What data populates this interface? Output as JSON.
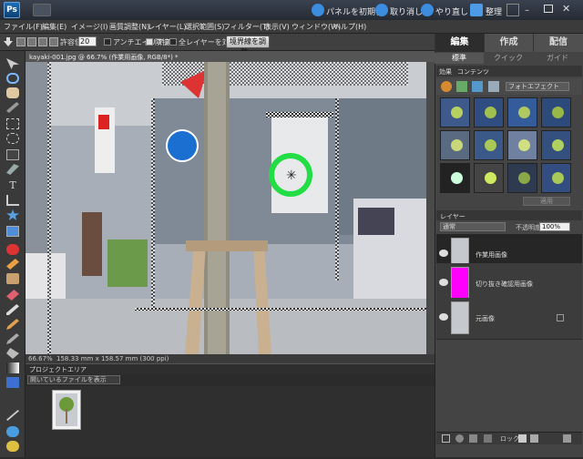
{
  "app": {
    "logo_text": "Ps"
  },
  "titlebar": {
    "reset_panels_label": "パネルを初期化",
    "undo_label": "取り消し",
    "redo_label": "やり直し",
    "organize_label": "整理"
  },
  "menu": [
    "ファイル(F)",
    "編集(E)",
    "イメージ(I)",
    "画質調整(N)",
    "レイヤー(L)",
    "選択範囲(S)",
    "フィルター(T)",
    "表示(V)",
    "ウィンドウ(W)",
    "ヘルプ(H)"
  ],
  "options": {
    "tolerance_label": "許容値:",
    "tolerance_value": "20",
    "antialias_label": "アンチエイリアス",
    "contiguous_label": "隣接",
    "all_layers_label": "全レイヤーを対象",
    "refine_edge_label": "境界線を調整..."
  },
  "document": {
    "tab_title": "kayaki-001.jpg @ 66.7% (作業用画像, RGB/8*) *",
    "zoom": "66.67%",
    "doc_size": "158.33 mm x 158.57 mm (300 ppi)"
  },
  "project_bin": {
    "title": "プロジェクトエリア",
    "filter_label": "開いているファイルを表示"
  },
  "right_panel": {
    "tabs": [
      "編集",
      "作成",
      "配信"
    ],
    "subtabs": [
      "標準",
      "クイック",
      "ガイド"
    ],
    "panel_tabs": [
      "効果",
      "コンテンツ"
    ],
    "effects_category": "フォトエフェクト",
    "apply_label": "適用",
    "layers_title": "レイヤー",
    "blend_mode": "通常",
    "opacity_label": "不透明度:",
    "opacity_value": "100%",
    "lock_label": "ロック:"
  },
  "layers": [
    {
      "name": "作業用画像",
      "selected": true,
      "thumb": "photo"
    },
    {
      "name": "切り抜き確認用画像",
      "selected": false,
      "thumb": "magenta"
    },
    {
      "name": "元画像",
      "selected": false,
      "thumb": "photo"
    }
  ],
  "colors": {
    "foreground": "#ff00ff",
    "background": "#ffffff",
    "selection_highlight": "#22dd44"
  },
  "icons": [
    "move-tool-icon",
    "zoom-tool-icon",
    "hand-tool-icon",
    "eyedropper-tool-icon",
    "marquee-tool-icon",
    "lasso-tool-icon",
    "magic-wand-tool-icon",
    "quick-selection-tool-icon",
    "type-tool-icon",
    "crop-tool-icon",
    "cookie-cutter-tool-icon",
    "straighten-tool-icon",
    "red-eye-tool-icon",
    "spot-healing-tool-icon",
    "clone-stamp-tool-icon",
    "eraser-tool-icon",
    "pencil-tool-icon",
    "brush-tool-icon",
    "smart-brush-tool-icon",
    "paint-bucket-tool-icon",
    "gradient-tool-icon",
    "shape-tool-icon",
    "blur-tool-icon",
    "sponge-tool-icon"
  ]
}
